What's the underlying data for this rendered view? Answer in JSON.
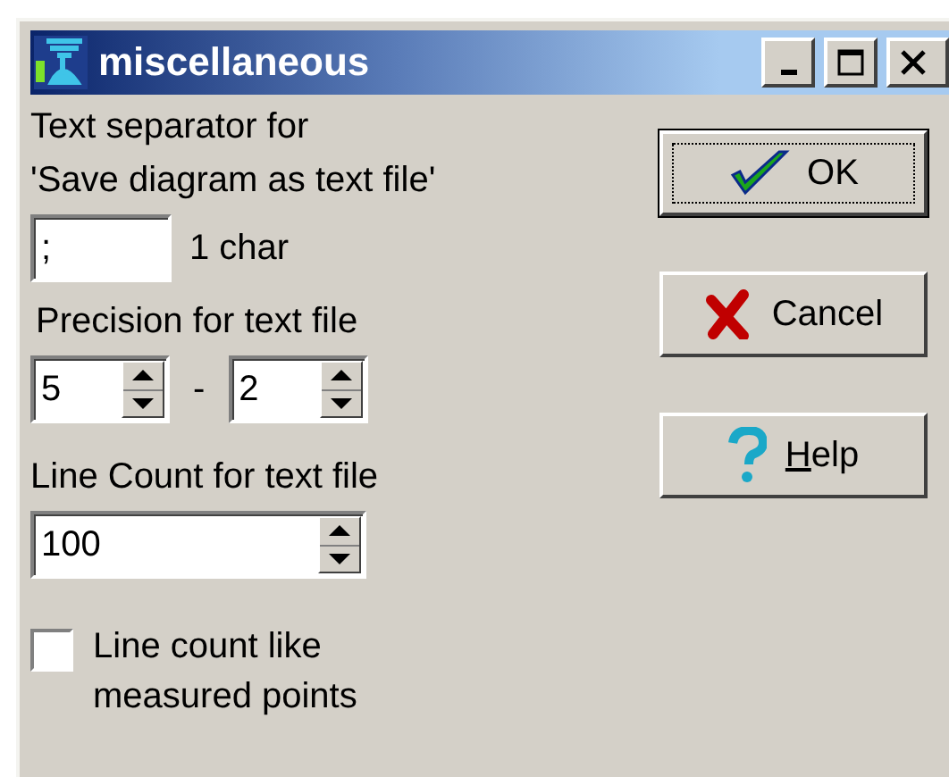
{
  "window": {
    "title": "miscellaneous"
  },
  "separator": {
    "label_lines": [
      "Text separator for",
      "'Save diagram as text file'"
    ],
    "value": ";",
    "hint": "1 char"
  },
  "precision": {
    "label": "Precision for text file",
    "value_1": "5",
    "dash": "-",
    "value_2": "2"
  },
  "line_count": {
    "label": "Line Count for text file",
    "value": "100"
  },
  "option": {
    "label_lines": [
      "Line count like",
      "measured points"
    ],
    "checked": false
  },
  "buttons": [
    {
      "kind": "ok",
      "label": "OK",
      "default": true
    },
    {
      "kind": "cancel",
      "label": "Cancel",
      "default": false
    },
    {
      "kind": "help",
      "label": "elp",
      "accel": "H",
      "default": false
    }
  ]
}
